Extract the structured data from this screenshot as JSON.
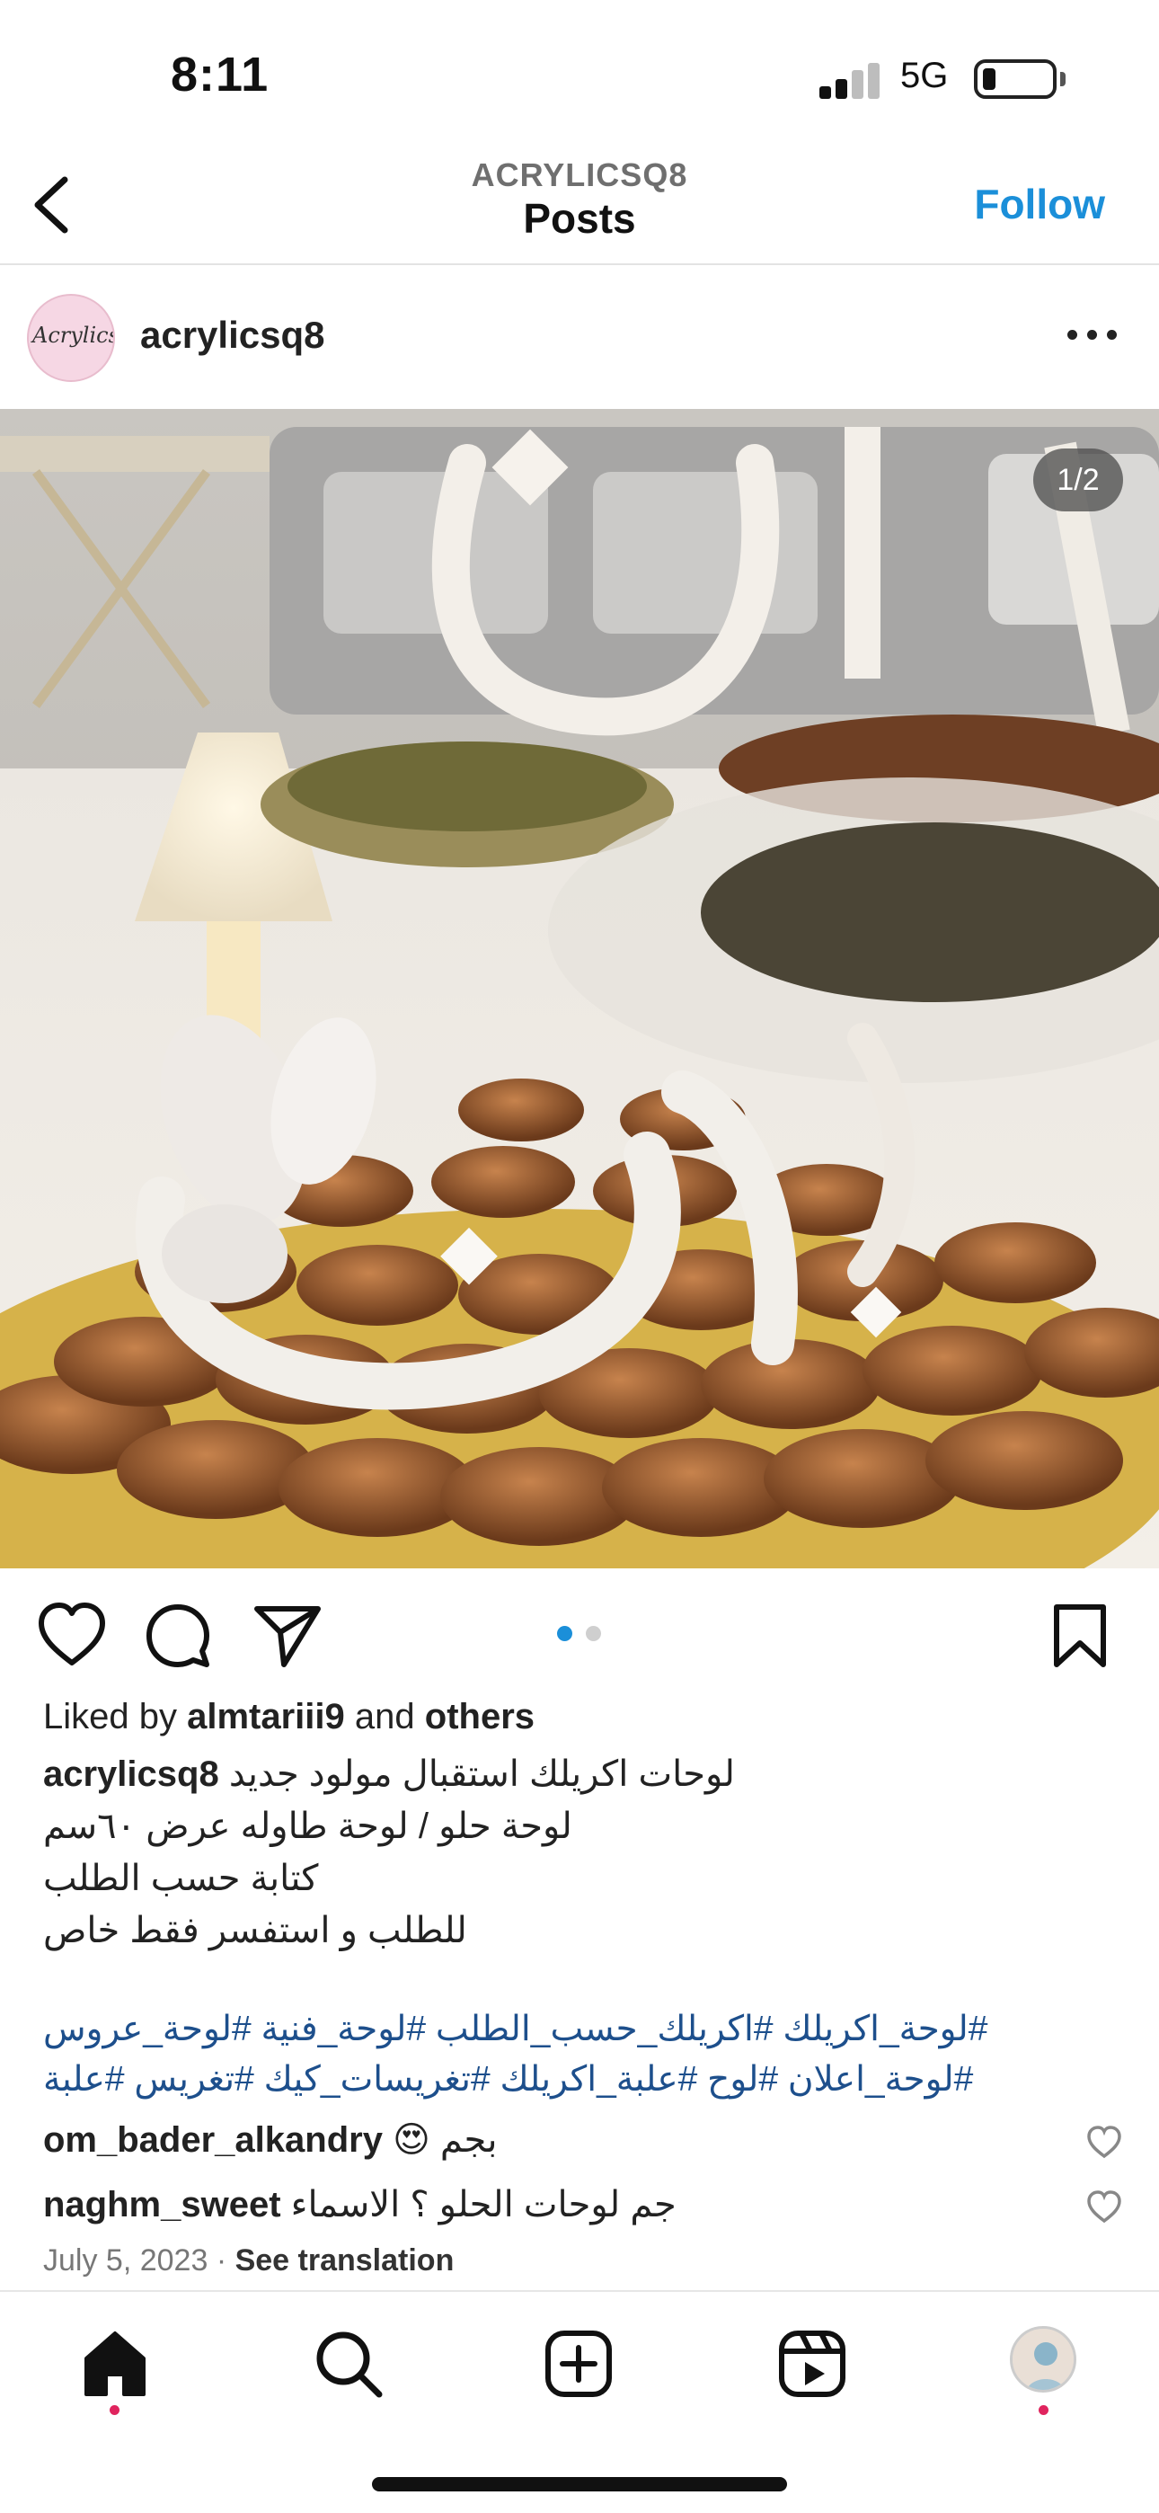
{
  "status_bar": {
    "time": "8:11",
    "network": "5G"
  },
  "header": {
    "account_label": "ACRYLICSQ8",
    "title": "Posts",
    "follow_label": "Follow"
  },
  "post": {
    "username": "acrylicsq8",
    "avatar_text": "Acrylics",
    "image_counter": "1/2",
    "carousel": {
      "total": 2,
      "current": 1
    },
    "likes": {
      "prefix": "Liked by",
      "user": "almtariii9",
      "middle": "and",
      "suffix": "others"
    },
    "caption": {
      "user": "acrylicsq8",
      "line1": "لوحات اكريلك استقبال مولود جديد",
      "line2": "لوحة حلو / لوحة طاوله عرض ٦٠سم",
      "line3": "كتابة حسب الطلب",
      "line4": "للطلب و استفسر فقط خاص"
    },
    "hashtags": {
      "line1": "#لوحة_اكريلك #اكريلك_حسب_الطلب #لوحة_فنية #لوحة_عروس",
      "line2": "#لوحة_اعلان #لوح #علبة_اكريلك #تغريسات_كيك #تغريس #علبة"
    },
    "comments": [
      {
        "user": "om_bader_alkandry",
        "text": "بجم 😍"
      },
      {
        "user": "naghm_sweet",
        "text": "جم لوحات الحلو ؟ الاسماء"
      }
    ],
    "date": "July 5, 2023",
    "separator": "·",
    "translation_label": "See translation"
  },
  "colors": {
    "accent": "#1b8fd9",
    "hashtag": "#1d4f8c",
    "notification": "#e0245e"
  },
  "icons": {
    "back": "chevron-left-icon",
    "more": "more-horizontal-icon",
    "like": "heart-icon",
    "comment": "comment-icon",
    "share": "send-icon",
    "save": "bookmark-icon",
    "home": "home-icon",
    "search": "search-icon",
    "create": "plus-square-icon",
    "reels": "reels-icon"
  }
}
